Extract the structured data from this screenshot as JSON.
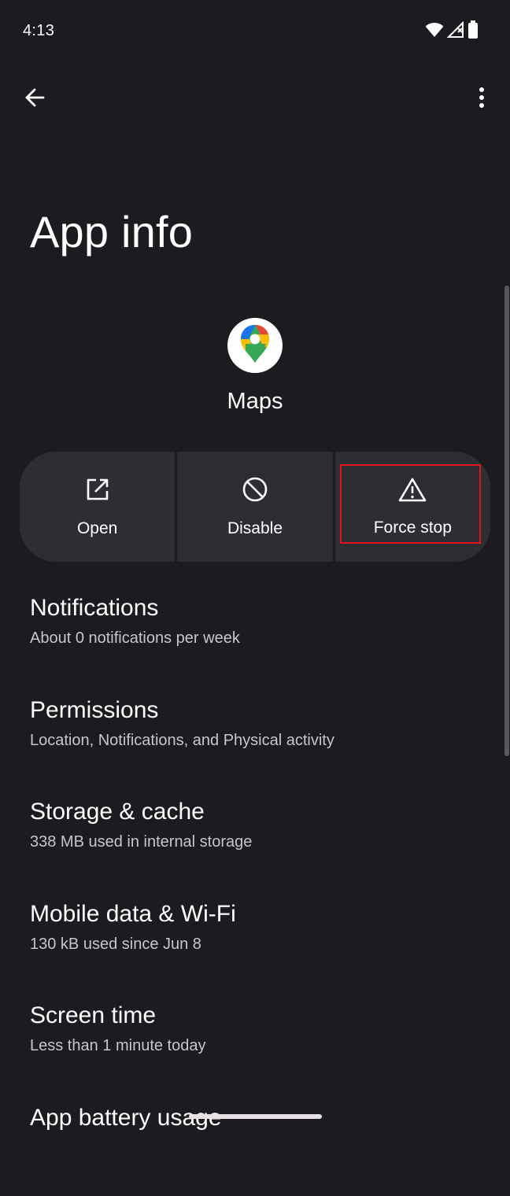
{
  "status_bar": {
    "time": "4:13",
    "icons": [
      "wifi-icon",
      "cellular-signal-icon",
      "battery-icon"
    ]
  },
  "top_bar": {
    "back_icon": "arrow-back-icon",
    "more_icon": "more-vert-icon"
  },
  "page": {
    "title": "App info"
  },
  "app": {
    "name": "Maps",
    "icon": "google-maps-icon"
  },
  "actions": [
    {
      "label": "Open",
      "icon": "open-external-icon"
    },
    {
      "label": "Disable",
      "icon": "disable-icon"
    },
    {
      "label": "Force stop",
      "icon": "warning-triangle-icon",
      "highlighted": true
    }
  ],
  "settings": [
    {
      "title": "Notifications",
      "subtitle": "About 0 notifications per week"
    },
    {
      "title": "Permissions",
      "subtitle": "Location, Notifications, and Physical activity"
    },
    {
      "title": "Storage & cache",
      "subtitle": "338 MB used in internal storage"
    },
    {
      "title": "Mobile data & Wi-Fi",
      "subtitle": "130 kB used since Jun 8"
    },
    {
      "title": "Screen time",
      "subtitle": "Less than 1 minute today"
    },
    {
      "title": "App battery usage",
      "subtitle": ""
    }
  ],
  "colors": {
    "background": "#1c1b1f",
    "button_surface": "#2e2d33",
    "highlight_outline": "#e3121b"
  }
}
